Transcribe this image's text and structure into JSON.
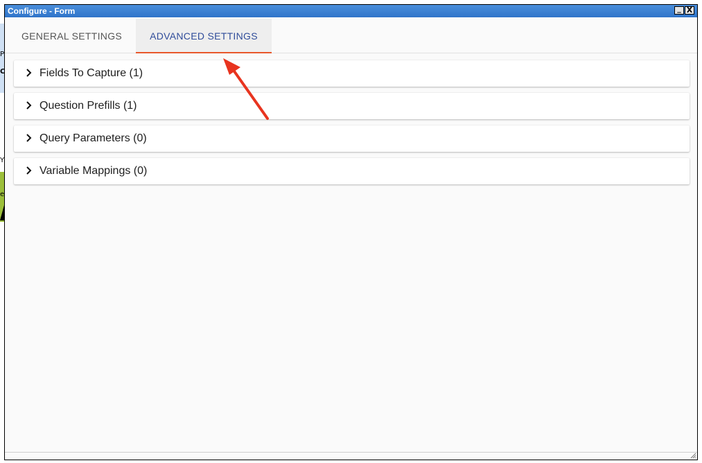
{
  "window": {
    "title": "Configure - Form",
    "minimize_glyph": "_",
    "close_glyph": "X"
  },
  "tabs": [
    {
      "label": "GENERAL SETTINGS",
      "active": false
    },
    {
      "label": "ADVANCED SETTINGS",
      "active": true
    }
  ],
  "sections": [
    {
      "label": "Fields To Capture (1)",
      "icon": "chevron-right-icon"
    },
    {
      "label": "Question Prefills (1)",
      "icon": "chevron-right-icon"
    },
    {
      "label": "Query Parameters (0)",
      "icon": "chevron-right-icon"
    },
    {
      "label": "Variable Mappings (0)",
      "icon": "chevron-right-icon"
    }
  ],
  "background_fragments": [
    "P",
    "C",
    "Y",
    "e"
  ],
  "colors": {
    "titlebar": "#2f74c9",
    "active_tab_text": "#2f4c9a",
    "active_tab_underline": "#e8572b",
    "annotation_arrow": "#e8341f"
  }
}
